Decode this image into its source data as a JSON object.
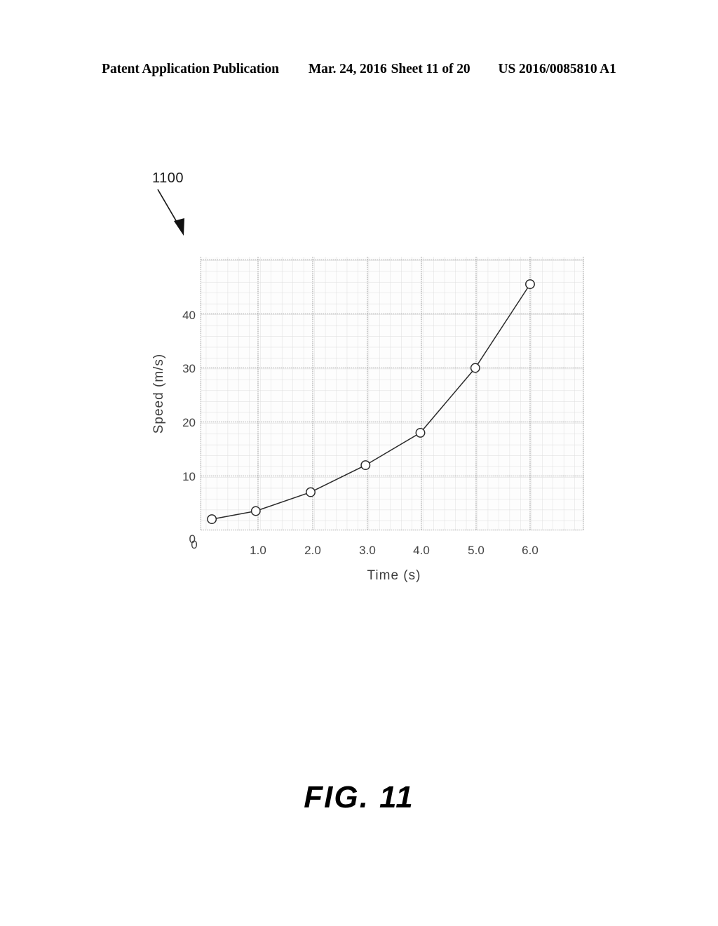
{
  "header": {
    "publication": "Patent Application Publication",
    "date": "Mar. 24, 2016",
    "sheet": "Sheet 11 of 20",
    "patent_number": "US 2016/0085810 A1"
  },
  "figure": {
    "caption": "FIG. 11",
    "reference_numeral": "1100",
    "callout_arrow": "arrow-down-right-icon"
  },
  "chart_data": {
    "type": "line",
    "title": "",
    "xlabel": "Time (s)",
    "ylabel": "Speed (m/s)",
    "xlim": [
      0,
      7.25
    ],
    "ylim": [
      0,
      52
    ],
    "xticks": [
      "0",
      "1.0",
      "2.0",
      "3.0",
      "4.0",
      "5.0",
      "6.0"
    ],
    "xtick_values": [
      0,
      1.0,
      2.0,
      3.0,
      4.0,
      5.0,
      6.0
    ],
    "yticks": [
      "0",
      "10",
      "20",
      "30",
      "40"
    ],
    "ytick_values": [
      0,
      10,
      20,
      30,
      40
    ],
    "grid": "major-and-minor",
    "grid_minor_per_major": 5,
    "legend": "none",
    "marker": "open-circle",
    "series": [
      {
        "name": "Speed",
        "x": [
          0.2,
          1.0,
          2.0,
          3.0,
          4.0,
          5.0,
          6.0
        ],
        "values": [
          2.0,
          3.5,
          7.0,
          12.0,
          18.0,
          30.0,
          45.5
        ]
      }
    ]
  },
  "colors": {
    "ink": "#000000",
    "grid_major": "#9a9a9a",
    "grid_minor": "#d8d8d8",
    "axis_text": "#3a3a3a",
    "plot_background": "#fcfcfc"
  }
}
